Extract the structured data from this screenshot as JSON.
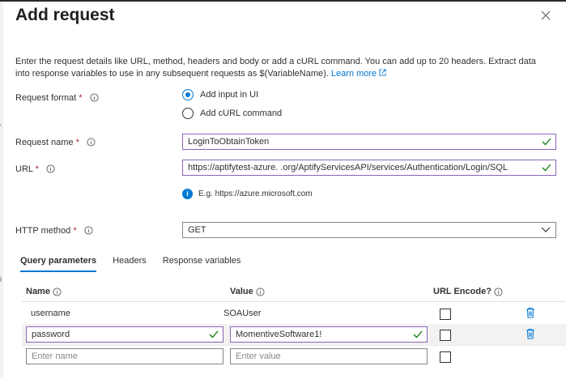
{
  "panel": {
    "title": "Add request",
    "description": "Enter the request details like URL, method, headers and body or add a cURL command. You can add up to 20 headers. Extract data into response variables to use in any subsequent requests as $(VariableName).",
    "learn_more": "Learn more"
  },
  "request_format": {
    "label": "Request format",
    "options": [
      "Add input in UI",
      "Add cURL command"
    ],
    "selected": "Add input in UI"
  },
  "request_name": {
    "label": "Request name",
    "value": "LoginToObtainToken"
  },
  "url": {
    "label": "URL",
    "value": "https://aptifytest-azure.            .org/AptifyServicesAPI/services/Authentication/Login/SQL",
    "hint": "E.g. https://azure.microsoft.com"
  },
  "http_method": {
    "label": "HTTP method",
    "value": "GET"
  },
  "tabs": [
    "Query parameters",
    "Headers",
    "Response variables"
  ],
  "table": {
    "columns": {
      "name": "Name",
      "value": "Value",
      "encode": "URL Encode?"
    },
    "rows": [
      {
        "name": "username",
        "value": "SOAUser",
        "encode": false
      },
      {
        "name": "password",
        "value": "MomentiveSoftware1!",
        "encode": false
      }
    ],
    "new_row": {
      "name_placeholder": "Enter name",
      "value_placeholder": "Enter value"
    }
  },
  "colors": {
    "accent": "#0078d4",
    "focus": "#8764b8",
    "valid": "#107c10",
    "required": "#a4262c"
  }
}
